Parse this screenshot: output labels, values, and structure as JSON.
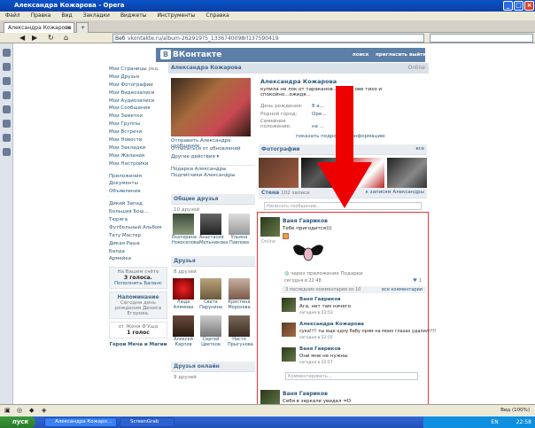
{
  "window": {
    "title": "Александра Кожарова - Opera"
  },
  "menu": [
    "Файл",
    "Правка",
    "Вид",
    "Закладки",
    "Виджеты",
    "Инструменты",
    "Справка"
  ],
  "tabs": [
    {
      "label": "Александра Кожарова"
    },
    {
      "label": ""
    }
  ],
  "address": {
    "prefix": "Веб",
    "url": "vkontakte.ru/album-262919?5_1336740098rl137590419"
  },
  "vk": {
    "brand": "ВКонтакте",
    "logo_letter": "В",
    "top_links": [
      "поиск",
      "пригласить",
      "выйти"
    ]
  },
  "nav": {
    "items": [
      "Мои Страницы",
      "Мои Друзья",
      "Мои Фотографии",
      "Мои Видеозаписи",
      "Мои Аудиозаписи",
      "Мои Сообщения",
      "Мои Заметки",
      "Мои Группы",
      "Мои Встречи",
      "Мои Новости",
      "Мои Закладки",
      "Мои Желания",
      "Мои Настройки"
    ],
    "edit": "ред.",
    "apps": [
      "Приложения",
      "Документы",
      "Объявления"
    ],
    "groups": [
      "Дикий Запад",
      "Большая Бош...",
      "Тюряга",
      "Футбольный Альбом",
      "Тату Мастер",
      "Дикая Раша",
      "Балда",
      "Армейка"
    ],
    "poll_title": "На Вашем счёте",
    "poll_votes": "3 голоса.",
    "poll_btn": "Пополнить Баланс",
    "remind_title": "Напоминание",
    "remind_text": "Сегодня день рождения Дениса Егорова.",
    "vote_from": "от Женя Ф'Уща",
    "vote_count": "1 голос",
    "footer": "Герои Меча и Магии"
  },
  "profile": {
    "header": "Александра Кожарова",
    "status": "Online",
    "name": "Александра Кожарова",
    "status_text": "купила не лок от тараканов...ся гол ове тихо и спокойно...ожидя...",
    "info": [
      {
        "label": "День рождения:",
        "value": "8 а..."
      },
      {
        "label": "Родной город:",
        "value": "Оре..."
      },
      {
        "label": "Семейное положение:",
        "value": "не ..."
      }
    ],
    "more": "показать подробную информацию",
    "actions": [
      "Отправить Александре сообщение",
      "Отписаться от обновлений",
      "Другие действия ▾",
      "Подарки Александры",
      "Подписчики Александры"
    ]
  },
  "photos": {
    "title": "Фотографии",
    "all": "все"
  },
  "friends": {
    "common_title": "Общие друзья",
    "common_count": "10 друзей",
    "common": [
      {
        "name": "Екатерина Новоселова"
      },
      {
        "name": "Анастасия Мельникова"
      },
      {
        "name": "Ульяна Павлова"
      }
    ],
    "title": "Друзья",
    "count": "8 друзей",
    "list": [
      {
        "name": "Люда Алямова"
      },
      {
        "name": "Света Парунина"
      },
      {
        "name": "Кристина Морозова"
      },
      {
        "name": "Алексей Карпов"
      },
      {
        "name": "Сергей Цветков"
      },
      {
        "name": "Настя Прыгунова"
      }
    ],
    "online_title": "Друзья онлайн",
    "online_count": "9 друзей"
  },
  "wall": {
    "title": "Стена",
    "count": "102 записи",
    "to_records": "к записям Александры",
    "placeholder": "Написать сообщение...",
    "post": {
      "author": "Ваня Гавриков",
      "text": "Тебе пригодится)))",
      "online": "Online",
      "via": "через приложение Подарки",
      "time": "сегодня в 22:48",
      "likes": "1",
      "comments_hdr": "3 последних комментария из 10",
      "all_comments": "все комментарии",
      "comments": [
        {
          "author": "Ваня Гавриков",
          "text": "Ага, нет там ничего",
          "time": "сегодня в 22:53"
        },
        {
          "author": "Александра Кожарова",
          "text": "сука!!!! ты еще одну бабу прям на моих глазах удалил!!!!",
          "time": "сегодня в 22:55"
        },
        {
          "author": "Ваня Гавриков",
          "text": "Они мне не нужны",
          "time": "сегодня в 22:57"
        }
      ],
      "comment_ph": "Комментировать..."
    },
    "post2": {
      "author": "Ваня Гавриков",
      "text": "Себя в зеркале увидел =D"
    }
  },
  "status": {
    "zoom": "Вид (100%)"
  },
  "taskbar": {
    "start": "пуск",
    "items": [
      "Александра Кожаро...",
      "ScreenGrab"
    ],
    "time": "22:58",
    "lang": "EN"
  }
}
